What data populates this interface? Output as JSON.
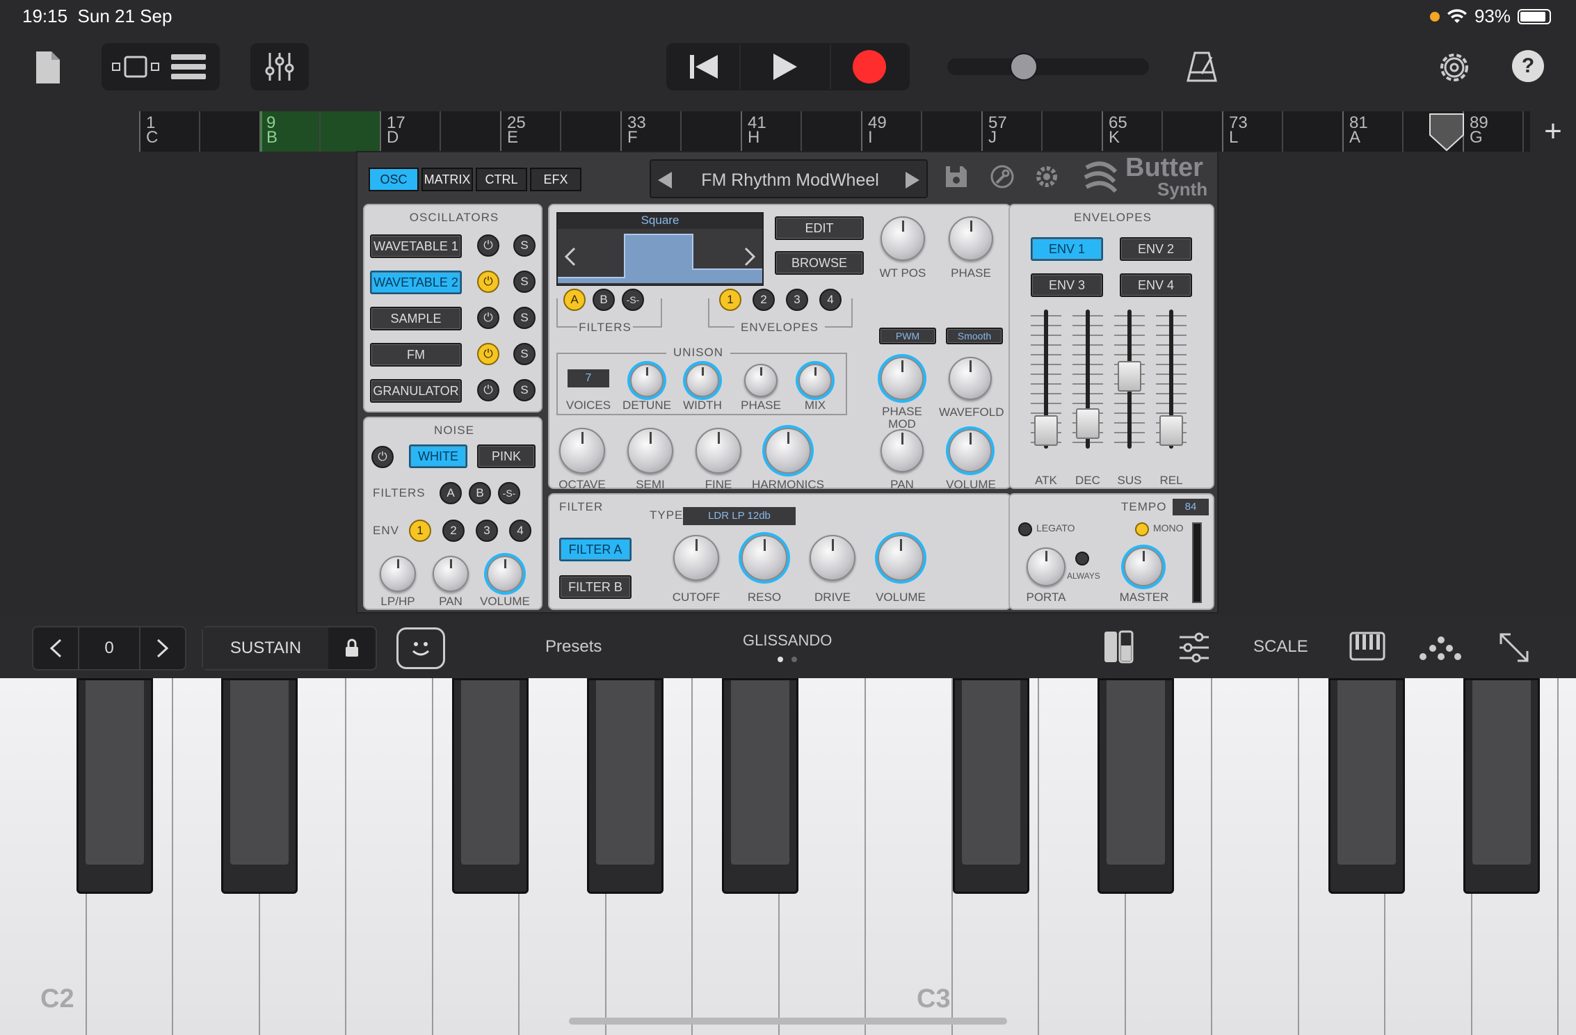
{
  "status_bar": {
    "time": "19:15",
    "date": "Sun 21 Sep",
    "battery": "93%"
  },
  "timeline": {
    "markers": [
      {
        "num": "1",
        "letter": "C"
      },
      {
        "num": "9",
        "letter": "B"
      },
      {
        "num": "17",
        "letter": "D"
      },
      {
        "num": "25",
        "letter": "E"
      },
      {
        "num": "33",
        "letter": "F"
      },
      {
        "num": "41",
        "letter": "H"
      },
      {
        "num": "49",
        "letter": "I"
      },
      {
        "num": "57",
        "letter": "J"
      },
      {
        "num": "65",
        "letter": "K"
      },
      {
        "num": "73",
        "letter": "L"
      },
      {
        "num": "81",
        "letter": "A"
      },
      {
        "num": "89",
        "letter": "G"
      }
    ],
    "add_label": "+"
  },
  "synth": {
    "tabs": [
      "OSC",
      "MATRIX",
      "CTRL",
      "EFX"
    ],
    "preset_name": "FM Rhythm ModWheel",
    "logo_line1": "Butter",
    "logo_line2": "Synth",
    "oscillators": {
      "title": "OSCILLATORS",
      "items": [
        "WAVETABLE 1",
        "WAVETABLE 2",
        "SAMPLE",
        "FM",
        "GRANULATOR"
      ],
      "solo_label": "S"
    },
    "noise": {
      "title": "NOISE",
      "white": "WHITE",
      "pink": "PINK",
      "filters_label": "FILTERS",
      "env_label": "ENV",
      "knobs": [
        "LP/HP",
        "PAN",
        "VOLUME"
      ]
    },
    "wave": {
      "display_title": "Square",
      "edit": "EDIT",
      "browse": "BROWSE",
      "wt_pos": "WT POS",
      "phase": "PHASE",
      "filters_label": "FILTERS",
      "envelopes_label": "ENVELOPES",
      "filter_btns": [
        "A",
        "B",
        "-S-"
      ],
      "env_btns": [
        "1",
        "2",
        "3",
        "4"
      ],
      "pwm": "PWM",
      "smooth": "Smooth",
      "unison": "UNISON",
      "voices_value": "7",
      "unison_knobs": [
        "VOICES",
        "DETUNE",
        "WIDTH",
        "PHASE",
        "MIX"
      ],
      "phase_mod": "PHASE\nMOD",
      "wavefold": "WAVEFOLD",
      "bottom_knobs": [
        "OCTAVE",
        "SEMI",
        "FINE",
        "HARMONICS"
      ],
      "pan": "PAN",
      "volume": "VOLUME"
    },
    "envelopes": {
      "title": "ENVELOPES",
      "buttons": [
        "ENV 1",
        "ENV 2",
        "ENV 3",
        "ENV 4"
      ],
      "faders": [
        "ATK",
        "DEC",
        "SUS",
        "REL"
      ]
    },
    "filter": {
      "title": "FILTER",
      "type_label": "TYPE",
      "type_value": "LDR LP 12db",
      "filter_a": "FILTER A",
      "filter_b": "FILTER B",
      "knobs": [
        "CUTOFF",
        "RESO",
        "DRIVE",
        "VOLUME"
      ]
    },
    "master": {
      "tempo_label": "TEMPO",
      "tempo_value": "84",
      "legato": "LEGATO",
      "mono": "MONO",
      "always": "ALWAYS",
      "porta": "PORTA",
      "master": "MASTER"
    }
  },
  "keybar": {
    "octave_value": "0",
    "sustain": "SUSTAIN",
    "presets": "Presets",
    "glissando": "GLISSANDO",
    "scale": "SCALE"
  },
  "keyboard": {
    "labels": [
      "C2",
      "C3"
    ]
  },
  "colors": {
    "accent_blue": "#29b6f6",
    "accent_yellow": "#f6c524",
    "record_red": "#ff2d2d"
  }
}
